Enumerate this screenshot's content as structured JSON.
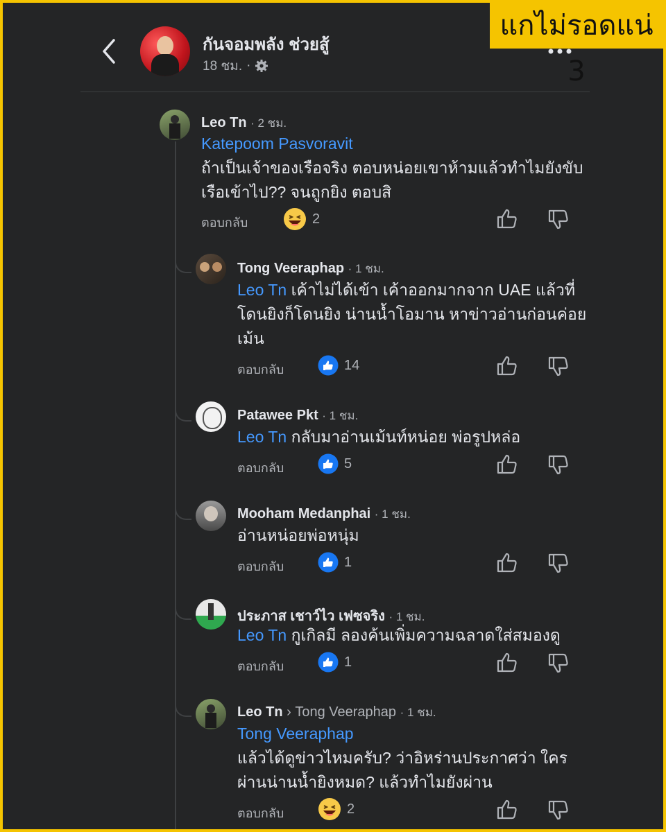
{
  "banner": "แกไม่รอดแน่ 3",
  "header": {
    "name": "กันจอมพลัง ช่วยสู้",
    "time": "18 ชม.",
    "separator": "·"
  },
  "labels": {
    "reply": "ตอบกลับ",
    "chevron": "›"
  },
  "comments": [
    {
      "name": "Leo Tn",
      "time": "· 2 ชม.",
      "mention": "Katepoom Pasvoravit",
      "line1": "ถ้าเป็นเจ้าของเรือจริง ตอบหน่อยเขาห้ามแล้วทำไมยังขับ",
      "line2": "เรือเข้าไป?? จนถูกยิง ตอบสิ",
      "reaction_type": "haha",
      "reaction_count": "2"
    },
    {
      "name": "Tong Veeraphap",
      "time": "· 1 ชม.",
      "mention": "Leo Tn",
      "line1": "เค้าไม่ได้เข้า เค้าออกมากจาก UAE แล้วที่",
      "line2": "โดนยิงก็โดนยิง น่านน้ำโอมาน หาข่าวอ่านก่อนค่อย",
      "line3": "เม้น",
      "reaction_type": "like",
      "reaction_count": "14"
    },
    {
      "name": "Patawee Pkt",
      "time": "· 1 ชม.",
      "mention": "Leo Tn",
      "line1": "กลับมาอ่านเม้นท์หน่อย พ่อรูปหล่อ",
      "reaction_type": "like",
      "reaction_count": "5"
    },
    {
      "name": "Mooham Medanphai",
      "time": "· 1 ชม.",
      "line1": "อ่านหน่อยพ่อหนุ่ม",
      "reaction_type": "like",
      "reaction_count": "1"
    },
    {
      "name": "ประภาส เชาว์ไว เฟซจริง",
      "time": "· 1 ชม.",
      "mention": "Leo Tn",
      "line1": "กูเกิลมี ลองค้นเพิ่มความฉลาดใส่สมองดู",
      "reaction_type": "like",
      "reaction_count": "1"
    },
    {
      "name": "Leo Tn",
      "reply_to": "Tong Veeraphap",
      "time": "· 1 ชม.",
      "mention": "Tong Veeraphap",
      "line1": "แล้วได้ดูข่าวไหมครับ? ว่าอิหร่านประกาศว่า ใคร",
      "line2": "ผ่านน่านน้ำยิงหมด? แล้วทำไมยังผ่าน",
      "reaction_type": "haha",
      "reaction_count": "2"
    }
  ],
  "colors": {
    "background": "#242526",
    "text": "#e4e6eb",
    "muted": "#b0b3b8",
    "mention": "#4599ff",
    "like": "#1877f2",
    "banner": "#f5c400"
  }
}
